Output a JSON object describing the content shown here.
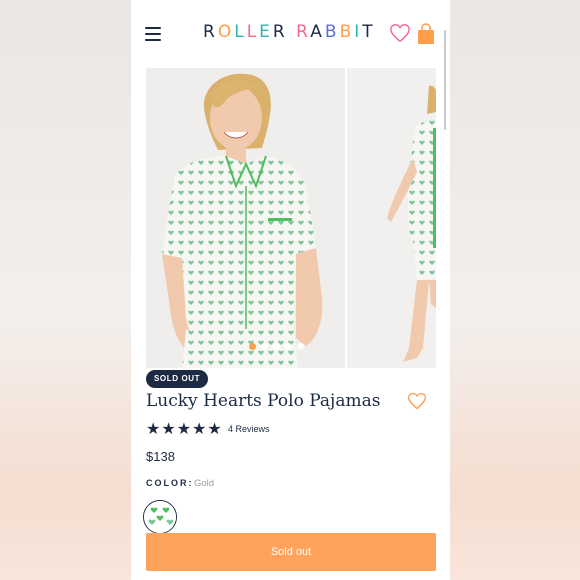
{
  "header": {
    "brand_letters": [
      "R",
      "O",
      "L",
      "L",
      "E",
      "R",
      " ",
      "R",
      "A",
      "B",
      "B",
      "I",
      "T"
    ],
    "brand_colors": [
      "#1d2a44",
      "#ff9e48",
      "#2fb5a8",
      "#f06b8f",
      "#2fb5a8",
      "#1d2a44",
      " ",
      "#f06b8f",
      "#1d2a44",
      "#5b6ee0",
      "#ff9e48",
      "#2fb5a8",
      "#1d2a44"
    ],
    "icons": [
      "menu-icon",
      "heart-icon",
      "shopping-bag-icon"
    ]
  },
  "gallery": {
    "slides": 2,
    "dot_count": 5,
    "active_dot": 0,
    "accent": "#ff9e48"
  },
  "product": {
    "badge": "SOLD OUT",
    "title": "Lucky Hearts Polo Pajamas",
    "rating": 5,
    "reviews": "4 Reviews",
    "price": "$138",
    "color_label": "COLOR:",
    "color_value": "Gold",
    "button_label": "Sold out"
  },
  "colors": {
    "navy": "#1d2a44",
    "orange": "#ffa35c",
    "heart": "#ff9e48"
  }
}
